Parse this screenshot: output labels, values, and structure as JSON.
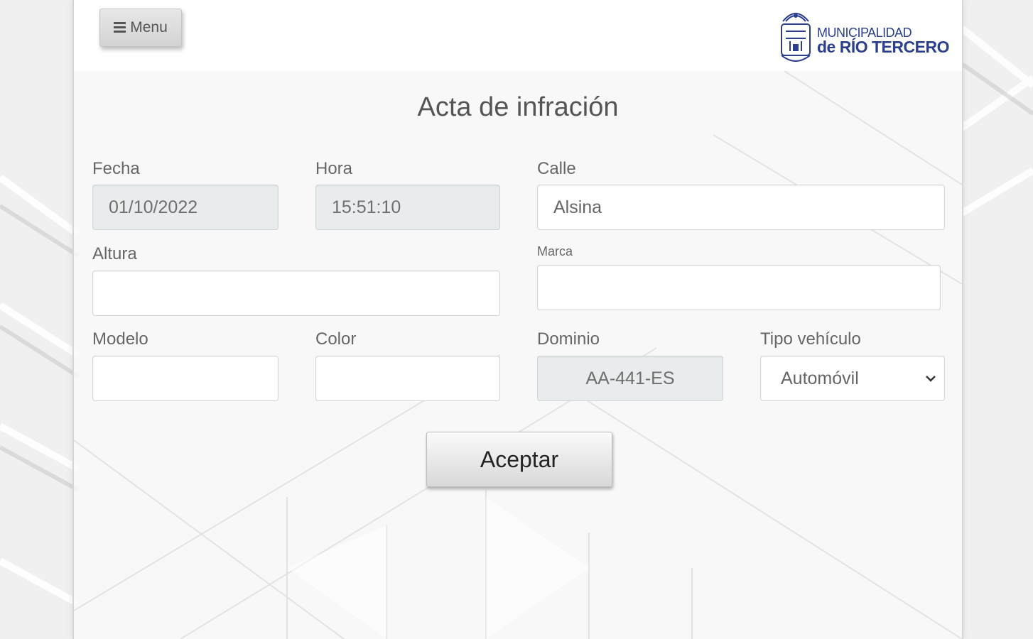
{
  "header": {
    "menu_label": "Menu",
    "logo": {
      "line1": "MUNICIPALIDAD",
      "line2": "de RÍO TERCERO",
      "brand_color": "#2b3f8e"
    }
  },
  "form": {
    "title": "Acta de infración",
    "fecha": {
      "label": "Fecha",
      "value": "01/10/2022"
    },
    "hora": {
      "label": "Hora",
      "value": "15:51:10"
    },
    "calle": {
      "label": "Calle",
      "value": "Alsina"
    },
    "altura": {
      "label": "Altura",
      "value": ""
    },
    "marca": {
      "label": "Marca",
      "value": ""
    },
    "modelo": {
      "label": "Modelo",
      "value": ""
    },
    "color": {
      "label": "Color",
      "value": ""
    },
    "dominio": {
      "label": "Dominio",
      "value": "AA-441-ES"
    },
    "tipo_vehiculo": {
      "label": "Tipo vehículo",
      "selected": "Automóvil"
    },
    "submit_label": "Aceptar"
  },
  "icons": {
    "menu": "hamburger-icon",
    "select": "chevron-down-icon",
    "seal": "municipal-seal-icon"
  }
}
